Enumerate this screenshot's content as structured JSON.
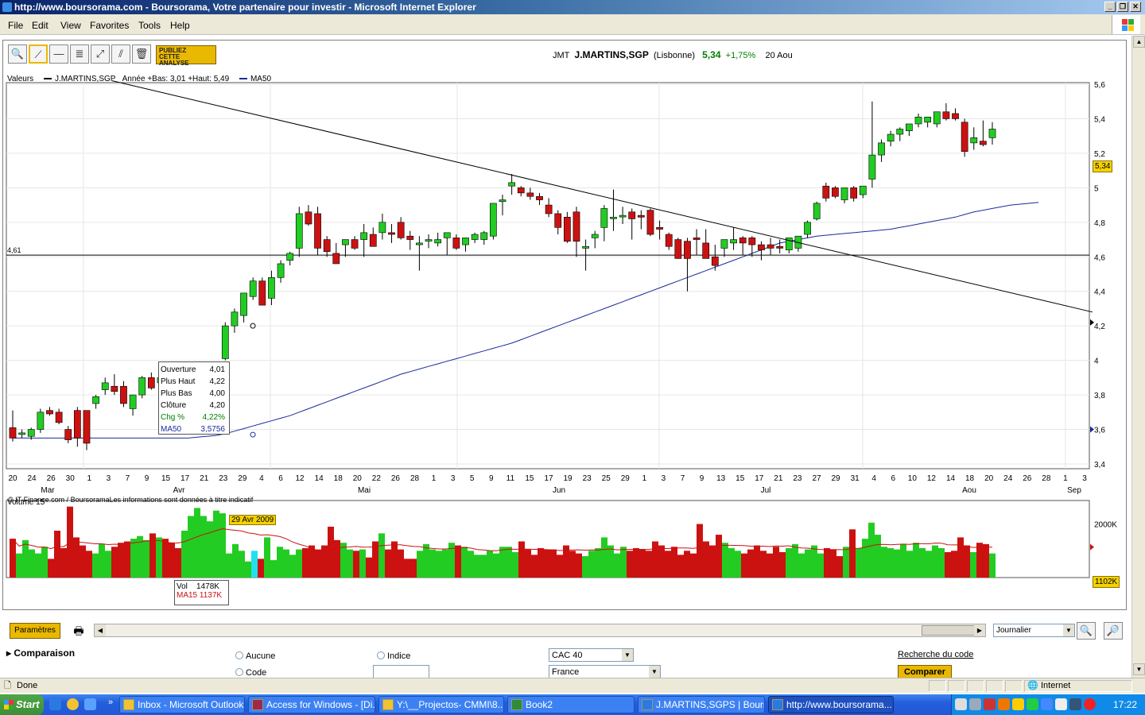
{
  "window": {
    "title": "http://www.boursorama.com - Boursorama, Votre partenaire pour investir - Microsoft Internet Explorer"
  },
  "menu": [
    "File",
    "Edit",
    "View",
    "Favorites",
    "Tools",
    "Help"
  ],
  "toolbar": {
    "publiez_line1": "PUBLIEZ",
    "publiez_line2": "CETTE",
    "publiez_line3": "ANALYSE"
  },
  "quote": {
    "ticker": "JMT",
    "name": "J.MARTINS,SGP",
    "market": "(Lisbonne)",
    "price": "5,34",
    "change": "+1,75%",
    "date": "20 Aou"
  },
  "legend": {
    "valeurs": "Valeurs",
    "series1": "J.MARTINS,SGP",
    "range": "Année +Bas: 3,01 +Haut: 5,49",
    "series2": "MA50"
  },
  "hline_label": "4,61",
  "copyright": "© IT-Finance.com / BoursoramaLes informations sont données à titre indicatif",
  "tooltip": {
    "ouverture_label": "Ouverture",
    "ouverture": "4,01",
    "haut_label": "Plus Haut",
    "haut": "4,22",
    "bas_label": "Plus Bas",
    "bas": "4,00",
    "cloture_label": "Clôture",
    "cloture": "4,20",
    "chg_label": "Chg %",
    "chg": "4,22%",
    "ma_label": "MA50",
    "ma": "3,5756"
  },
  "date_badge": "29 Avr 2009",
  "price_badge": "5,34",
  "volume": {
    "label": "Volume 15",
    "tip_vol_label": "Vol",
    "tip_vol": "1478K",
    "tip_ma_label": "MA15",
    "tip_ma": "1137K",
    "badge": "1102K",
    "ytick": "2000K"
  },
  "controls": {
    "params": "Paramètres",
    "period": "Journalier"
  },
  "comparaison": {
    "title": "Comparaison",
    "aucune": "Aucune",
    "code": "Code",
    "indice": "Indice",
    "index_select": "CAC 40",
    "country_select": "France",
    "recherche": "Recherche du code",
    "comparer": "Comparer"
  },
  "status": {
    "text": "Done",
    "zone": "Internet"
  },
  "taskbar": {
    "start": "Start",
    "tasks": [
      "Inbox - Microsoft Outlook",
      "Access for Windows - [Di...",
      "Y:\\__Projectos- CMMI\\8...",
      "Book2",
      "J.MARTINS,SGPS | Bours...",
      "http://www.boursorama..."
    ],
    "clock": "17:22"
  },
  "colors": {
    "up": "#22cc22",
    "down": "#cc1111",
    "ma": "#1a2a9a",
    "badge": "#f5d100"
  },
  "chart_data": {
    "type": "candlestick",
    "ylim": [
      3.4,
      5.6
    ],
    "yticks": [
      "5,6",
      "5,4",
      "5,2",
      "5",
      "4,8",
      "4,6",
      "4,4",
      "4,2",
      "4",
      "3,8",
      "3,6",
      "3,4"
    ],
    "xticks": [
      "20",
      "24",
      "26",
      "30",
      "1",
      "3",
      "7",
      "9",
      "15",
      "17",
      "21",
      "23",
      "29",
      "4",
      "6",
      "12",
      "14",
      "18",
      "20",
      "22",
      "26",
      "28",
      "1",
      "3",
      "5",
      "9",
      "11",
      "15",
      "17",
      "19",
      "23",
      "25",
      "29",
      "1",
      "3",
      "7",
      "9",
      "13",
      "15",
      "17",
      "21",
      "23",
      "27",
      "29",
      "31",
      "4",
      "6",
      "10",
      "12",
      "14",
      "18",
      "20",
      "24",
      "26",
      "28",
      "1",
      "3"
    ],
    "months": [
      "Mar",
      "Avr",
      "Mai",
      "Jun",
      "Jul",
      "Aou",
      "Sep"
    ],
    "candles": [
      [
        3.61,
        3.71,
        3.53,
        3.55
      ],
      [
        3.58,
        3.6,
        3.55,
        3.58
      ],
      [
        3.56,
        3.61,
        3.54,
        3.6
      ],
      [
        3.6,
        3.72,
        3.58,
        3.7
      ],
      [
        3.71,
        3.73,
        3.68,
        3.69
      ],
      [
        3.7,
        3.72,
        3.63,
        3.64
      ],
      [
        3.6,
        3.62,
        3.52,
        3.54
      ],
      [
        3.71,
        3.73,
        3.5,
        3.55
      ],
      [
        3.71,
        3.71,
        3.48,
        3.52
      ],
      [
        3.75,
        3.8,
        3.72,
        3.79
      ],
      [
        3.83,
        3.9,
        3.8,
        3.87
      ],
      [
        3.85,
        3.92,
        3.8,
        3.82
      ],
      [
        3.85,
        3.88,
        3.73,
        3.75
      ],
      [
        3.72,
        3.8,
        3.68,
        3.8
      ],
      [
        3.8,
        3.91,
        3.78,
        3.9
      ],
      [
        3.9,
        3.93,
        3.83,
        3.84
      ],
      [
        3.87,
        3.91,
        3.79,
        3.9
      ],
      [
        3.87,
        3.89,
        3.7,
        3.85
      ],
      [
        3.84,
        3.85,
        3.78,
        3.8
      ],
      [
        3.82,
        3.85,
        3.79,
        3.84
      ],
      [
        3.9,
        3.95,
        3.87,
        3.93
      ],
      [
        3.94,
        3.98,
        3.9,
        3.97
      ],
      [
        3.9,
        3.94,
        3.88,
        3.93
      ],
      [
        4.01,
        4.22,
        4.0,
        4.2
      ],
      [
        4.2,
        4.3,
        4.16,
        4.28
      ],
      [
        4.26,
        4.39,
        4.22,
        4.39
      ],
      [
        4.37,
        4.48,
        4.35,
        4.46
      ],
      [
        4.46,
        4.48,
        4.32,
        4.32
      ],
      [
        4.36,
        4.52,
        4.32,
        4.48
      ],
      [
        4.48,
        4.58,
        4.45,
        4.56
      ],
      [
        4.58,
        4.63,
        4.55,
        4.62
      ],
      [
        4.65,
        4.89,
        4.6,
        4.85
      ],
      [
        4.86,
        4.9,
        4.78,
        4.79
      ],
      [
        4.85,
        4.89,
        4.61,
        4.65
      ],
      [
        4.7,
        4.72,
        4.6,
        4.63
      ],
      [
        4.62,
        4.68,
        4.56,
        4.56
      ],
      [
        4.67,
        4.7,
        4.6,
        4.7
      ],
      [
        4.7,
        4.72,
        4.64,
        4.65
      ],
      [
        4.7,
        4.79,
        4.6,
        4.74
      ],
      [
        4.73,
        4.77,
        4.66,
        4.66
      ],
      [
        4.74,
        4.85,
        4.7,
        4.8
      ],
      [
        4.74,
        4.79,
        4.68,
        4.73
      ],
      [
        4.8,
        4.83,
        4.7,
        4.71
      ],
      [
        4.72,
        4.75,
        4.64,
        4.7
      ],
      [
        4.67,
        4.72,
        4.52,
        4.68
      ],
      [
        4.7,
        4.73,
        4.65,
        4.7
      ],
      [
        4.68,
        4.74,
        4.66,
        4.7
      ],
      [
        4.71,
        4.74,
        4.61,
        4.74
      ],
      [
        4.71,
        4.73,
        4.64,
        4.65
      ],
      [
        4.67,
        4.71,
        4.63,
        4.71
      ],
      [
        4.7,
        4.74,
        4.68,
        4.73
      ],
      [
        4.7,
        4.75,
        4.67,
        4.74
      ],
      [
        4.72,
        4.9,
        4.7,
        4.91
      ],
      [
        4.92,
        4.96,
        4.84,
        4.93
      ],
      [
        5.01,
        5.08,
        4.96,
        5.03
      ],
      [
        5.0,
        5.01,
        4.95,
        4.97
      ],
      [
        4.97,
        5.0,
        4.93,
        4.95
      ],
      [
        4.95,
        4.97,
        4.9,
        4.93
      ],
      [
        4.9,
        4.94,
        4.83,
        4.85
      ],
      [
        4.85,
        4.87,
        4.73,
        4.77
      ],
      [
        4.83,
        4.86,
        4.68,
        4.69
      ],
      [
        4.86,
        4.89,
        4.6,
        4.69
      ],
      [
        4.65,
        4.7,
        4.52,
        4.66
      ],
      [
        4.71,
        4.75,
        4.65,
        4.73
      ],
      [
        4.77,
        4.9,
        4.69,
        4.88
      ],
      [
        4.83,
        4.99,
        4.75,
        4.83
      ],
      [
        4.84,
        4.89,
        4.79,
        4.84
      ],
      [
        4.86,
        4.88,
        4.7,
        4.82
      ],
      [
        4.84,
        4.87,
        4.76,
        4.83
      ],
      [
        4.87,
        4.88,
        4.72,
        4.73
      ],
      [
        4.77,
        4.81,
        4.7,
        4.76
      ],
      [
        4.73,
        4.74,
        4.64,
        4.66
      ],
      [
        4.7,
        4.71,
        4.6,
        4.59
      ],
      [
        4.69,
        4.71,
        4.4,
        4.59
      ],
      [
        4.71,
        4.76,
        4.61,
        4.7
      ],
      [
        4.68,
        4.76,
        4.6,
        4.59
      ],
      [
        4.6,
        4.67,
        4.52,
        4.55
      ],
      [
        4.65,
        4.7,
        4.6,
        4.7
      ],
      [
        4.68,
        4.77,
        4.64,
        4.7
      ],
      [
        4.71,
        4.72,
        4.61,
        4.68
      ],
      [
        4.71,
        4.72,
        4.6,
        4.67
      ],
      [
        4.67,
        4.69,
        4.58,
        4.64
      ],
      [
        4.67,
        4.71,
        4.61,
        4.65
      ],
      [
        4.66,
        4.7,
        4.62,
        4.65
      ],
      [
        4.64,
        4.7,
        4.62,
        4.71
      ],
      [
        4.65,
        4.72,
        4.63,
        4.72
      ],
      [
        4.73,
        4.81,
        4.71,
        4.8
      ],
      [
        4.82,
        4.92,
        4.81,
        4.91
      ],
      [
        5.01,
        5.03,
        4.92,
        4.94
      ],
      [
        5.0,
        5.01,
        4.94,
        4.95
      ],
      [
        4.93,
        5.0,
        4.91,
        5.0
      ],
      [
        5.0,
        5.01,
        4.92,
        4.94
      ],
      [
        4.96,
        5.01,
        4.94,
        5.01
      ],
      [
        5.05,
        5.5,
        5.0,
        5.19
      ],
      [
        5.19,
        5.28,
        5.15,
        5.26
      ],
      [
        5.27,
        5.33,
        5.24,
        5.31
      ],
      [
        5.31,
        5.35,
        5.27,
        5.34
      ],
      [
        5.33,
        5.37,
        5.3,
        5.37
      ],
      [
        5.37,
        5.43,
        5.35,
        5.41
      ],
      [
        5.38,
        5.41,
        5.35,
        5.41
      ],
      [
        5.37,
        5.44,
        5.35,
        5.44
      ],
      [
        5.44,
        5.49,
        5.39,
        5.4
      ],
      [
        5.43,
        5.46,
        5.39,
        5.4
      ],
      [
        5.38,
        5.4,
        5.18,
        5.21
      ],
      [
        5.26,
        5.35,
        5.22,
        5.29
      ],
      [
        5.27,
        5.39,
        5.24,
        5.25
      ],
      [
        5.29,
        5.38,
        5.25,
        5.34
      ]
    ],
    "ma50": [
      3.55,
      3.55,
      3.55,
      3.55,
      3.55,
      3.55,
      3.55,
      3.55,
      3.55,
      3.55,
      3.55,
      3.55,
      3.55,
      3.55,
      3.55,
      3.55,
      3.55,
      3.55,
      3.55,
      3.55,
      3.555,
      3.56,
      3.565,
      3.575,
      3.59,
      3.605,
      3.62,
      3.635,
      3.65,
      3.665,
      3.68,
      3.7,
      3.72,
      3.74,
      3.76,
      3.78,
      3.8,
      3.82,
      3.84,
      3.86,
      3.88,
      3.9,
      3.92,
      3.935,
      3.95,
      3.965,
      3.98,
      3.995,
      4.01,
      4.025,
      4.04,
      4.055,
      4.07,
      4.085,
      4.1,
      4.12,
      4.14,
      4.16,
      4.18,
      4.2,
      4.22,
      4.24,
      4.26,
      4.28,
      4.3,
      4.32,
      4.34,
      4.36,
      4.38,
      4.4,
      4.42,
      4.44,
      4.46,
      4.48,
      4.5,
      4.52,
      4.54,
      4.56,
      4.58,
      4.6,
      4.62,
      4.64,
      4.66,
      4.68,
      4.69,
      4.7,
      4.71,
      4.72,
      4.725,
      4.73,
      4.735,
      4.74,
      4.745,
      4.75,
      4.755,
      4.76,
      4.77,
      4.78,
      4.79,
      4.8,
      4.81,
      4.82,
      4.83,
      4.845,
      4.86,
      4.87,
      4.88,
      4.89,
      4.9,
      4.905,
      4.91,
      4.915
    ],
    "trendline": {
      "from": [
        0,
        5.62
      ],
      "to": [
        120,
        4.28
      ]
    },
    "hline": 4.61,
    "volume_k": [
      1450,
      900,
      1400,
      1050,
      900,
      1150,
      700,
      1750,
      1100,
      2650,
      1500,
      1200,
      1000,
      900,
      1250,
      1000,
      1150,
      1300,
      1350,
      1450,
      1550,
      1400,
      1650,
      1500,
      1450,
      1300,
      1100,
      1750,
      2300,
      2600,
      2300,
      2100,
      2500,
      2400,
      900,
      1250,
      1000,
      600,
      1000,
      700,
      1500,
      650,
      1150,
      1050,
      850,
      1050,
      1100,
      1200,
      1050,
      1200,
      1900,
      1400,
      1300,
      1050,
      1000,
      1050,
      750,
      1350,
      1650,
      1050,
      1350,
      1050,
      700,
      700,
      1000,
      1250,
      1050,
      1000,
      1050,
      1300,
      1200,
      1150,
      1000,
      850,
      850,
      1000,
      900,
      1150,
      1150,
      950,
      1350,
      1050,
      850,
      1100,
      1050,
      1050,
      850,
      1200,
      1000,
      900,
      800,
      1000,
      1100,
      1500,
      1200,
      900,
      1150,
      1000,
      1100,
      1050,
      1000,
      1350,
      1200,
      1000,
      1150,
      850,
      1000,
      900,
      2000,
      1350,
      1200,
      1600,
      1300,
      1100,
      1000,
      900,
      1050,
      1200,
      1000,
      900,
      1150,
      950,
      1100,
      1250,
      900,
      1050,
      1200,
      900,
      1100,
      1050,
      800,
      1150,
      1800,
      1100,
      1450,
      2050,
      1600,
      1150,
      1100,
      1050,
      1250,
      1000,
      1300,
      1100,
      1000,
      1200,
      1100,
      950,
      1000,
      1500,
      1200,
      950,
      1300,
      1250,
      900
    ],
    "volume_ma15_k": 1137
  }
}
